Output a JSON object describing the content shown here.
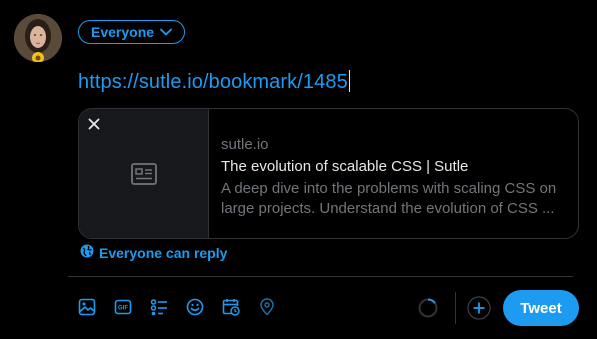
{
  "audience": {
    "label": "Everyone",
    "icon": "chevron-down-icon"
  },
  "compose": {
    "text": "https://sutle.io/bookmark/1485"
  },
  "link_card": {
    "domain": "sutle.io",
    "title": "The evolution of scalable CSS | Sutle",
    "description": "A deep dive into the problems with scaling CSS on large projects. Understand the evolution of CSS ...",
    "close_icon": "close-icon",
    "thumbnail_icon": "article-placeholder-icon"
  },
  "reply_setting": {
    "label": "Everyone can reply",
    "icon": "globe-icon"
  },
  "toolbar": {
    "items": [
      "image-icon",
      "gif-icon",
      "poll-icon",
      "emoji-icon",
      "schedule-icon",
      "location-icon"
    ]
  },
  "actions": {
    "tweet_label": "Tweet",
    "add_icon": "plus-icon"
  },
  "colors": {
    "accent": "#1d9bf0",
    "background": "#000000",
    "border": "#2f3336",
    "muted_text": "#71767b",
    "text": "#e7e9ea"
  }
}
